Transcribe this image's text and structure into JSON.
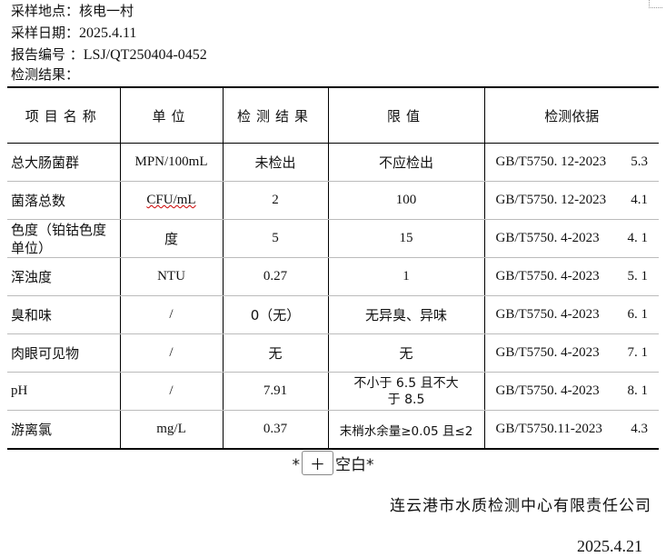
{
  "header": {
    "location_label": "采样地点：",
    "location_value": "核电一村",
    "date_label": "采样日期：",
    "date_value": "2025.4.11",
    "report_label": "报告编号 ：",
    "report_value": "LSJ/QT250404-0452",
    "result_label": "检测结果："
  },
  "table": {
    "columns": [
      "项目名称",
      "单位",
      "检测结果",
      "限值",
      "检测依据"
    ],
    "rows": [
      {
        "item": "总大肠菌群",
        "unit": "MPN/100mL",
        "result": "未检出",
        "limit": "不应检出",
        "std": "GB/T5750. 12-2023",
        "clause": "5.3"
      },
      {
        "item": "菌落总数",
        "unit": "CFU/mL",
        "result": "2",
        "limit": "100",
        "std": "GB/T5750. 12-2023",
        "clause": "4.1"
      },
      {
        "item": "色度（铂钴色度单位）",
        "unit": "度",
        "result": "5",
        "limit": "15",
        "std": "GB/T5750. 4-2023",
        "clause": "4. 1"
      },
      {
        "item": "浑浊度",
        "unit": "NTU",
        "result": "0.27",
        "limit": "1",
        "std": "GB/T5750. 4-2023",
        "clause": "5. 1"
      },
      {
        "item": "臭和味",
        "unit": "/",
        "result": "0（无）",
        "limit": "无异臭、异味",
        "std": "GB/T5750. 4-2023",
        "clause": "6. 1"
      },
      {
        "item": "肉眼可见物",
        "unit": "/",
        "result": "无",
        "limit": "无",
        "std": "GB/T5750. 4-2023",
        "clause": "7. 1"
      },
      {
        "item": "pH",
        "unit": "/",
        "result": "7.91",
        "limit": "不小于 6.5 且不大于 8.5",
        "std": "GB/T5750. 4-2023",
        "clause": "8. 1"
      },
      {
        "item": "游离氯",
        "unit": "mg/L",
        "result": "0.37",
        "limit": "末梢水余量≥0.05 且≤2",
        "std": "GB/T5750.11-2023",
        "clause": "4.3"
      }
    ]
  },
  "footer": {
    "blank_prefix": "*",
    "blank_box": "＋",
    "blank_text": "空白*",
    "company": "连云港市水质检测中心有限责任公司",
    "date": "2025.4.21"
  }
}
